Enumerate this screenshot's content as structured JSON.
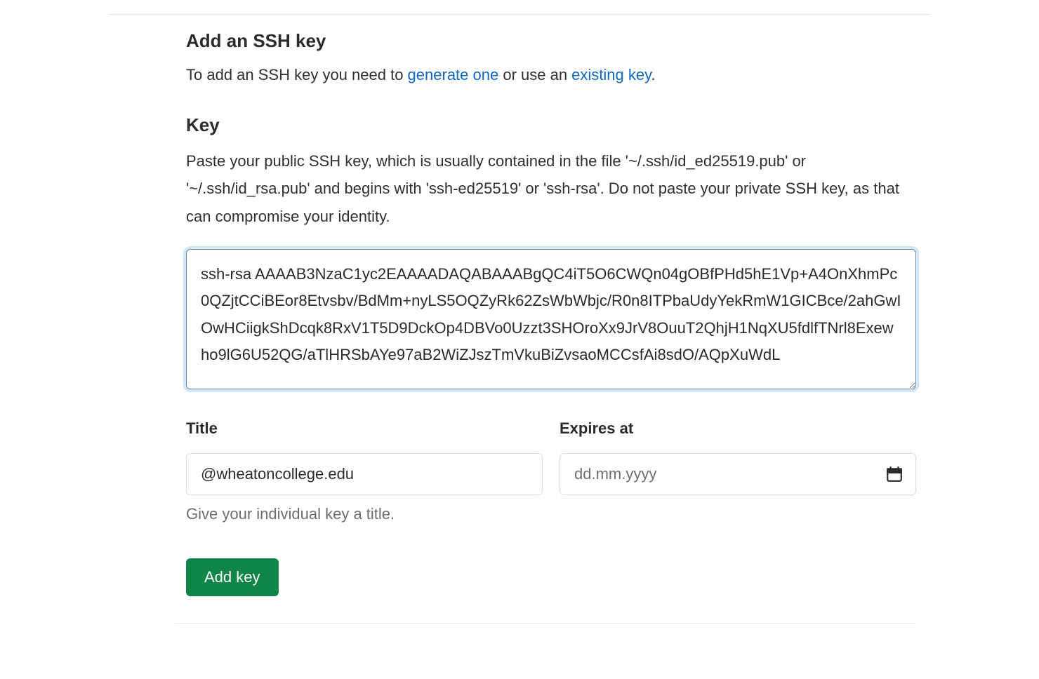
{
  "section": {
    "title": "Add an SSH key",
    "intro_prefix": "To add an SSH key you need to ",
    "link_generate": "generate one",
    "intro_mid": " or use an ",
    "link_existing": "existing key",
    "intro_suffix": "."
  },
  "key_field": {
    "label": "Key",
    "help": "Paste your public SSH key, which is usually contained in the file '~/.ssh/id_ed25519.pub' or '~/.ssh/id_rsa.pub' and begins with 'ssh-ed25519' or 'ssh-rsa'. Do not paste your private SSH key, as that can compromise your identity.",
    "value": "ssh-rsa AAAAB3NzaC1yc2EAAAADAQABAAABgQC4iT5O6CWQn04gOBfPHd5hE1Vp+A4OnXhmPc0QZjtCCiBEor8Etvsbv/BdMm+nyLS5OQZyRk62ZsWbWbjc/R0n8ITPbaUdyYekRmW1GICBce/2ahGwIOwHCiigkShDcqk8RxV1T5D9DckOp4DBVo0Uzzt3SHOroXx9JrV8OuuT2QhjH1NqXU5fdlfTNrl8Exewho9lG6U52QG/aTlHRSbAYe97aB2WiZJszTmVkuBiZvsaoMCCsfAi8sdO/AQpXuWdL"
  },
  "title_field": {
    "label": "Title",
    "value": "@wheatoncollege.edu",
    "help": "Give your individual key a title."
  },
  "expires_field": {
    "label": "Expires at",
    "placeholder": "dd.mm.yyyy"
  },
  "submit": {
    "label": "Add key"
  }
}
